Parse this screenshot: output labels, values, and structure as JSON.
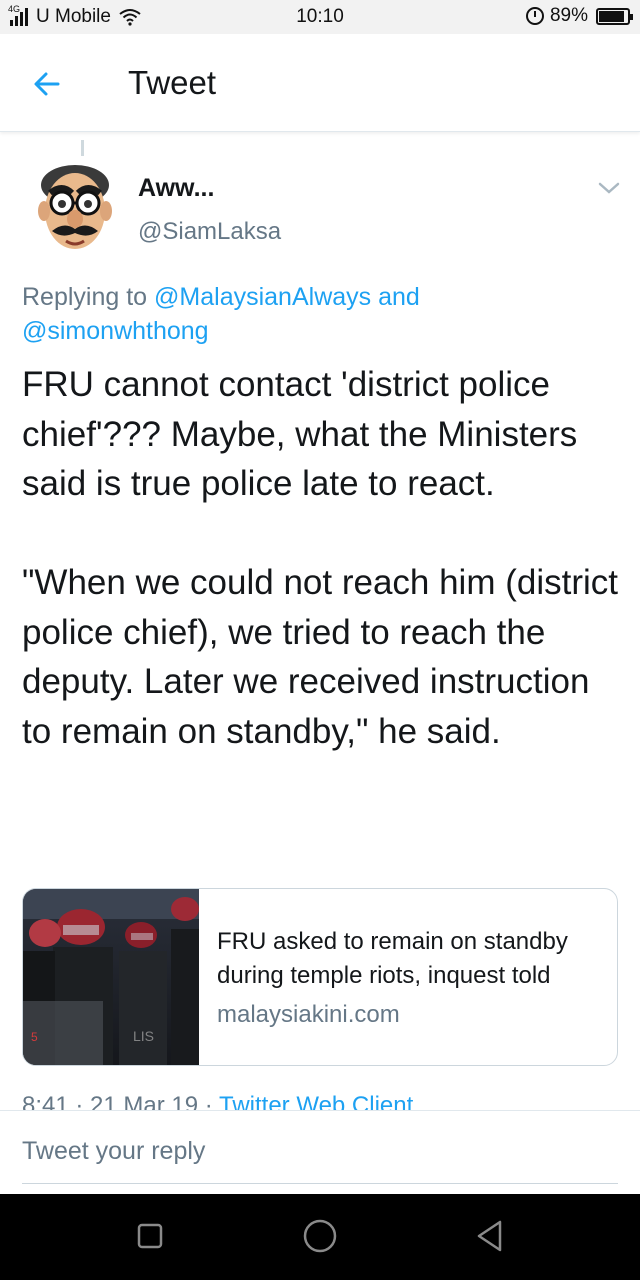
{
  "status_bar": {
    "network_tag": "4G",
    "carrier": "U Mobile",
    "time": "10:10",
    "battery_percent": "89%",
    "battery_level": 0.89,
    "icons": [
      "signal-icon",
      "wifi-icon",
      "alarm-icon",
      "battery-icon"
    ]
  },
  "header": {
    "title": "Tweet",
    "back_icon": "arrow-left-icon"
  },
  "tweet": {
    "display_name": "Aww...",
    "handle": "@SiamLaksa",
    "caret_icon": "chevron-down-icon",
    "replying_prefix": "Replying to ",
    "replying_mention_1": "@MalaysianAlways",
    "replying_joiner": " and",
    "replying_mention_2": "@simonwhthong",
    "body": "FRU cannot contact 'district police chief'??? Maybe, what the Ministers said is true police late to react.\n\n\"When we could not reach him (district police chief), we tried to reach the deputy. Later we received instruction to remain on standby,\" he said.",
    "meta_datetime": "8:41 · 21 Mar 19 · ",
    "meta_client": "Twitter Web Client"
  },
  "link_card": {
    "title": "FRU asked to remain on standby during temple riots, inquest told",
    "domain": "malaysiakini.com"
  },
  "composer": {
    "placeholder": "Tweet your reply"
  },
  "nav_bar": {
    "icons": [
      "recents-square-icon",
      "home-circle-icon",
      "back-triangle-icon"
    ]
  },
  "colors": {
    "accent": "#1da1f2",
    "secondary_text": "#657786",
    "primary_text": "#14171a"
  }
}
